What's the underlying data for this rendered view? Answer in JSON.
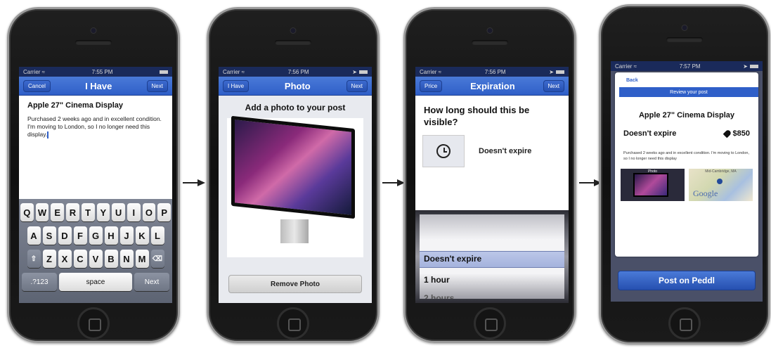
{
  "screens": [
    {
      "status": {
        "carrier": "Carrier",
        "time": "7:55 PM"
      },
      "nav": {
        "left": "Cancel",
        "title": "I Have",
        "right": "Next"
      },
      "post_title": "Apple 27\" Cinema Display",
      "post_body": "Purchased 2 weeks ago and in excellent condition. I'm moving to London, so I no longer need this display.",
      "keyboard": {
        "row1": [
          "Q",
          "W",
          "E",
          "R",
          "T",
          "Y",
          "U",
          "I",
          "O",
          "P"
        ],
        "row2": [
          "A",
          "S",
          "D",
          "F",
          "G",
          "H",
          "J",
          "K",
          "L"
        ],
        "row3": [
          "Z",
          "X",
          "C",
          "V",
          "B",
          "N",
          "M"
        ],
        "numbers": ".?123",
        "space": "space",
        "next": "Next"
      }
    },
    {
      "status": {
        "carrier": "Carrier",
        "time": "7:56 PM"
      },
      "nav": {
        "left": "I Have",
        "title": "Photo",
        "right": "Next"
      },
      "heading": "Add a photo to your post",
      "remove": "Remove Photo"
    },
    {
      "status": {
        "carrier": "Carrier",
        "time": "7:56 PM"
      },
      "nav": {
        "left": "Price",
        "title": "Expiration",
        "right": "Next"
      },
      "heading": "How long should this be visible?",
      "value": "Doesn't expire",
      "picker": [
        "Doesn't expire",
        "1 hour",
        "2 hours"
      ]
    },
    {
      "status": {
        "carrier": "Carrier",
        "time": "7:57 PM"
      },
      "back": "Back",
      "banner": "Review your post",
      "title": "Apple 27\" Cinema Display",
      "expiry": "Doesn't expire",
      "price": "$850",
      "description": "Purchased 2 weeks ago and in excellent condition. I'm moving to London, so I no longer need this display",
      "photo_label": "Photo",
      "map_label": "Mid-Cambridge, MA",
      "map_brand": "Google",
      "post_button": "Post on Peddl"
    }
  ],
  "icons": [
    "wifi-icon",
    "battery-icon",
    "location-icon",
    "shift-icon",
    "backspace-icon",
    "clock-icon",
    "price-tag-icon",
    "map-pin-icon",
    "right-arrow-icon"
  ]
}
